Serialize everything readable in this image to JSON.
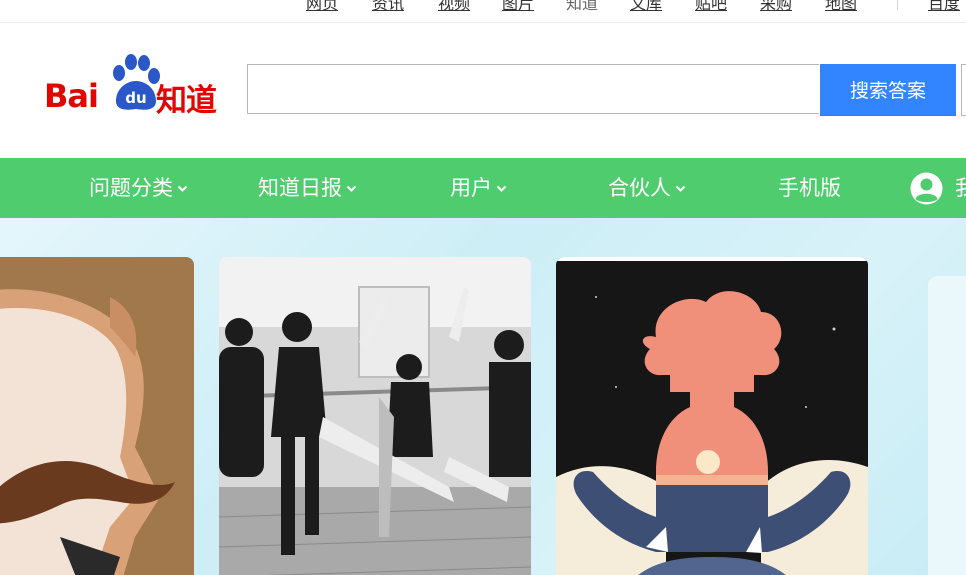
{
  "topnav": {
    "items": [
      {
        "label": "网页",
        "current": false
      },
      {
        "label": "资讯",
        "current": false
      },
      {
        "label": "视频",
        "current": false
      },
      {
        "label": "图片",
        "current": false
      },
      {
        "label": "知道",
        "current": true
      },
      {
        "label": "文库",
        "current": false
      },
      {
        "label": "贴吧",
        "current": false
      },
      {
        "label": "采购",
        "current": false
      },
      {
        "label": "地图",
        "current": false
      }
    ],
    "more_label": "百度"
  },
  "logo": {
    "bai_text": "Bai",
    "du_text": "du",
    "zhidao_text": "知道",
    "brand_color": "#e10601",
    "paw_color": "#2b58c8"
  },
  "search": {
    "value": "",
    "placeholder": "",
    "button_label": "搜索答案",
    "button_color": "#3385ff"
  },
  "greennav": {
    "background": "#4fcc6e",
    "items": [
      {
        "label": "问题分类",
        "dropdown": true
      },
      {
        "label": "知道日报",
        "dropdown": true
      },
      {
        "label": "用户",
        "dropdown": true
      },
      {
        "label": "合伙人",
        "dropdown": true
      },
      {
        "label": "手机版",
        "dropdown": false
      }
    ],
    "user_label": "我"
  },
  "banner": {
    "cards": [
      {
        "icon": "mustache-man-illustration"
      },
      {
        "icon": "ballet-dancers-photo"
      },
      {
        "icon": "meditation-silhouette-illustration"
      }
    ]
  }
}
